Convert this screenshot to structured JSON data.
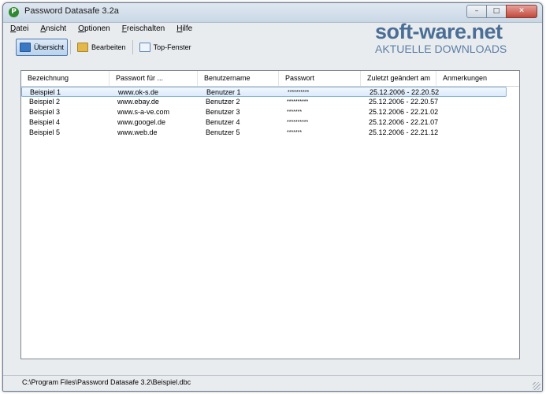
{
  "window": {
    "title": "Password Datasafe 3.2a",
    "icon_letter": "P",
    "controls": [
      "–",
      "□",
      "✕"
    ]
  },
  "menu": [
    {
      "accel": "D",
      "rest": "atei"
    },
    {
      "accel": "A",
      "rest": "nsicht"
    },
    {
      "accel": "O",
      "rest": "ptionen"
    },
    {
      "accel": "F",
      "rest": "reischalten"
    },
    {
      "accel": "H",
      "rest": "ilfe"
    }
  ],
  "toolbar": [
    {
      "label": "Übersicht",
      "icon": "overview-icon",
      "active": true
    },
    {
      "label": "Bearbeiten",
      "icon": "edit-icon",
      "active": false
    },
    {
      "label": "Top-Fenster",
      "icon": "window-icon",
      "active": false
    }
  ],
  "watermark": {
    "main": "soft-ware.net",
    "sub": "AKTUELLE DOWNLOADS"
  },
  "table": {
    "columns": [
      "Bezeichnung",
      "Passwort für ...",
      "Benutzername",
      "Passwort",
      "Zuletzt geändert am",
      "Anmerkungen"
    ],
    "rows": [
      [
        "Beispiel 1",
        "www.ok-s.de",
        "Benutzer 1",
        "**********",
        "25.12.2006 - 22.20.52",
        ""
      ],
      [
        "Beispiel 2",
        "www.ebay.de",
        "Benutzer 2",
        "**********",
        "25.12.2006 - 22.20.57",
        ""
      ],
      [
        "Beispiel 3",
        "www.s-a-ve.com",
        "Benutzer 3",
        "*******",
        "25.12.2006 - 22.21.02",
        ""
      ],
      [
        "Beispiel 4",
        "www.googel.de",
        "Benutzer 4",
        "**********",
        "25.12.2006 - 22.21.07",
        ""
      ],
      [
        "Beispiel 5",
        "www.web.de",
        "Benutzer 5",
        "*******",
        "25.12.2006 - 22.21.12",
        ""
      ]
    ],
    "selected_row": 0
  },
  "statusbar": {
    "path": "C:\\Program Files\\Password Datasafe 3.2\\Beispiel.dbc"
  },
  "colors": {
    "accent": "#4d78a8",
    "selection": "#dbeafb",
    "watermark": "#4a6e95",
    "close_button": "#c0483a"
  }
}
